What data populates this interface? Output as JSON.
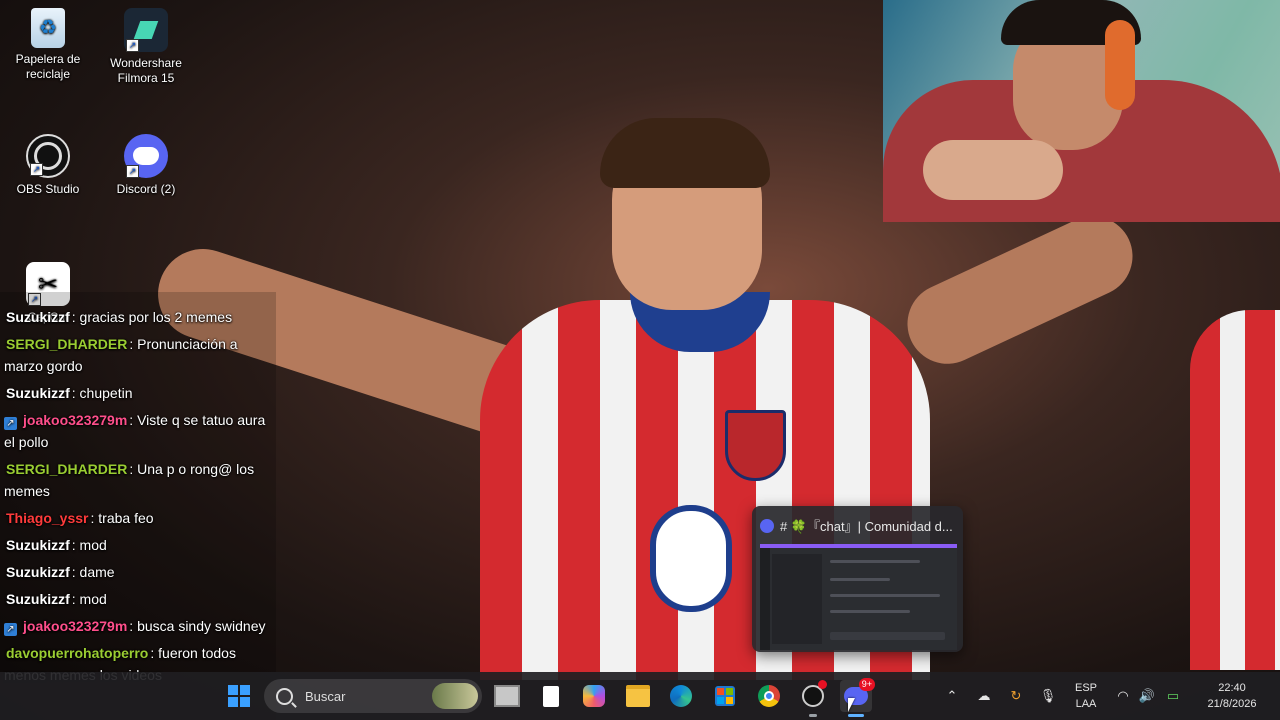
{
  "desktop_icons": [
    {
      "label": "Papelera de\nreciclaje",
      "icon": "recycle-bin-icon"
    },
    {
      "label": "Wondershare\nFilmora 15",
      "icon": "filmora-icon"
    },
    {
      "label": "OBS Studio",
      "icon": "obs-icon"
    },
    {
      "label": "Discord (2)",
      "icon": "discord-icon"
    },
    {
      "label": "CapCut",
      "icon": "capcut-icon"
    }
  ],
  "chat": {
    "messages": [
      {
        "user": "Suzukizzf",
        "text": ": gracias por los 2 memes",
        "color": "#ffffff",
        "badge": false
      },
      {
        "user": "SERGI_DHARDER",
        "text": ": Pronunciación a marzo gordo",
        "color": "#9acd32",
        "badge": false
      },
      {
        "user": "Suzukizzf",
        "text": ": chupetin",
        "color": "#ffffff",
        "badge": false
      },
      {
        "user": "joakoo323279m",
        "text": ": Viste q se tatuo aura el pollo",
        "color": "#ff4f8b",
        "badge": true
      },
      {
        "user": "SERGI_DHARDER",
        "text": ": Una p o rong@ los memes",
        "color": "#9acd32",
        "badge": false
      },
      {
        "user": "Thiago_yssr",
        "text": ": traba feo",
        "color": "#ff3b3b",
        "badge": false
      },
      {
        "user": "Suzukizzf",
        "text": ": mod",
        "color": "#ffffff",
        "badge": false
      },
      {
        "user": "Suzukizzf",
        "text": ": dame",
        "color": "#ffffff",
        "badge": false
      },
      {
        "user": "Suzukizzf",
        "text": ": mod",
        "color": "#ffffff",
        "badge": false
      },
      {
        "user": "joakoo323279m",
        "text": ": busca sindy swidney",
        "color": "#ff4f8b",
        "badge": true
      },
      {
        "user": "davopuerrohatoperro",
        "text": ": fueron todos menos memes los videos",
        "color": "#9acd32",
        "badge": false
      }
    ]
  },
  "thumbnail": {
    "title": "# 🍀『chat』| Comunidad d..."
  },
  "taskbar": {
    "search_placeholder": "Buscar",
    "discord_badge": "9+",
    "language": [
      "ESP",
      "LAA"
    ],
    "time": "22:40",
    "date": "21/8/2026",
    "icons": [
      "windows-start-icon",
      "search-icon",
      "task-view-icon",
      "notepad-icon",
      "microsoft-365-icon",
      "file-explorer-icon",
      "edge-icon",
      "microsoft-store-icon",
      "chrome-icon",
      "obs-icon",
      "discord-icon",
      "chevron-up-icon",
      "onedrive-icon",
      "refresh-icon",
      "microphone-icon",
      "wifi-icon",
      "volume-icon",
      "battery-icon"
    ]
  }
}
